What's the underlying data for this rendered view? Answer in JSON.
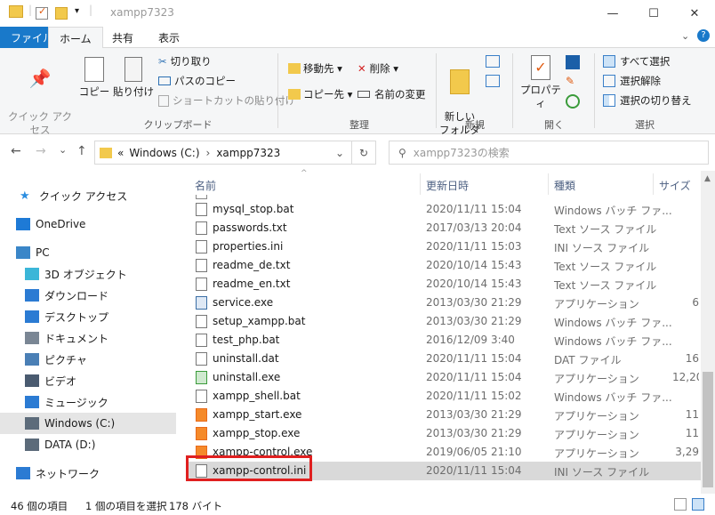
{
  "window": {
    "title": "xampp7323",
    "minimize": "—",
    "maximize": "☐",
    "close": "✕"
  },
  "tabs": {
    "file": "ファイル",
    "home": "ホーム",
    "share": "共有",
    "view": "表示"
  },
  "ribbon": {
    "pin_label": "クイック アクセス\nにピン留めする",
    "copy": "コピー",
    "paste": "貼り付け",
    "cut": "切り取り",
    "copy_path": "パスのコピー",
    "paste_shortcut": "ショートカットの貼り付け",
    "clipboard_group": "クリップボード",
    "move_to": "移動先 ▾",
    "delete": "削除 ▾",
    "copy_to": "コピー先 ▾",
    "rename": "名前の変更",
    "organize_group": "整理",
    "new_folder": "新しい\nフォルダー",
    "new_group": "新規",
    "properties": "プロパティ",
    "open_group": "開く",
    "select_all": "すべて選択",
    "select_none": "選択解除",
    "invert_selection": "選択の切り替え",
    "select_group": "選択"
  },
  "address": {
    "root": "«",
    "drive": "Windows (C:)",
    "sep1": "›",
    "folder": "xampp7323",
    "dropdown": "⌄",
    "refresh": "↻",
    "search_placeholder": "xampp7323の検索"
  },
  "nav_arrows": {
    "back": "←",
    "forward": "→",
    "down": "⌄",
    "up": "↑"
  },
  "nav": [
    {
      "label": "クイック アクセス",
      "icon": "star-icon",
      "color": "#2b8ee0"
    },
    {
      "label": "OneDrive",
      "icon": "cloud-icon",
      "color": "#1e7ad6"
    },
    {
      "label": "PC",
      "icon": "pc-icon",
      "color": "#3a86c8"
    },
    {
      "label": "3D オブジェクト",
      "icon": "cube-icon",
      "color": "#3bb6d8"
    },
    {
      "label": "ダウンロード",
      "icon": "download-icon",
      "color": "#2b7bd3"
    },
    {
      "label": "デスクトップ",
      "icon": "desktop-icon",
      "color": "#2b7bd3"
    },
    {
      "label": "ドキュメント",
      "icon": "document-icon",
      "color": "#7a8694"
    },
    {
      "label": "ピクチャ",
      "icon": "picture-icon",
      "color": "#4a7fb5"
    },
    {
      "label": "ビデオ",
      "icon": "video-icon",
      "color": "#4a5b70"
    },
    {
      "label": "ミュージック",
      "icon": "music-icon",
      "color": "#2b7bd3"
    },
    {
      "label": "Windows (C:)",
      "icon": "drive-icon",
      "color": "#5c6b7a"
    },
    {
      "label": "DATA (D:)",
      "icon": "drive-icon",
      "color": "#5c6b7a"
    },
    {
      "label": "ネットワーク",
      "icon": "network-icon",
      "color": "#2b7bd3"
    }
  ],
  "columns": {
    "name": "名前",
    "date": "更新日時",
    "type": "種類",
    "size": "サイズ"
  },
  "files": [
    {
      "name": "mysql_stop.bat",
      "date": "2020/11/11 15:04",
      "type": "Windows バッチ ファ...",
      "size": "",
      "icon": "bat"
    },
    {
      "name": "passwords.txt",
      "date": "2017/03/13 20:04",
      "type": "Text ソース ファイル",
      "size": "",
      "icon": "txt"
    },
    {
      "name": "properties.ini",
      "date": "2020/11/11 15:03",
      "type": "INI ソース ファイル",
      "size": "",
      "icon": "ini"
    },
    {
      "name": "readme_de.txt",
      "date": "2020/10/14 15:43",
      "type": "Text ソース ファイル",
      "size": "",
      "icon": "txt"
    },
    {
      "name": "readme_en.txt",
      "date": "2020/10/14 15:43",
      "type": "Text ソース ファイル",
      "size": "",
      "icon": "txt"
    },
    {
      "name": "service.exe",
      "date": "2013/03/30 21:29",
      "type": "アプリケーション",
      "size": "6",
      "icon": "exe"
    },
    {
      "name": "setup_xampp.bat",
      "date": "2013/03/30 21:29",
      "type": "Windows バッチ ファ...",
      "size": "",
      "icon": "bat"
    },
    {
      "name": "test_php.bat",
      "date": "2016/12/09 3:40",
      "type": "Windows バッチ ファ...",
      "size": "",
      "icon": "bat"
    },
    {
      "name": "uninstall.dat",
      "date": "2020/11/11 15:04",
      "type": "DAT ファイル",
      "size": "16",
      "icon": "dat"
    },
    {
      "name": "uninstall.exe",
      "date": "2020/11/11 15:04",
      "type": "アプリケーション",
      "size": "12,20",
      "icon": "uninst"
    },
    {
      "name": "xampp_shell.bat",
      "date": "2020/11/11 15:02",
      "type": "Windows バッチ ファ...",
      "size": "",
      "icon": "bat"
    },
    {
      "name": "xampp_start.exe",
      "date": "2013/03/30 21:29",
      "type": "アプリケーション",
      "size": "11",
      "icon": "xampp"
    },
    {
      "name": "xampp_stop.exe",
      "date": "2013/03/30 21:29",
      "type": "アプリケーション",
      "size": "11",
      "icon": "xampp"
    },
    {
      "name": "xampp-control.exe",
      "date": "2019/06/05 21:10",
      "type": "アプリケーション",
      "size": "3,29",
      "icon": "xampp"
    },
    {
      "name": "xampp-control.ini",
      "date": "2020/11/11 15:04",
      "type": "INI ソース ファイル",
      "size": "",
      "icon": "ini"
    }
  ],
  "selected_index": 14,
  "highlight_color": "#e02020",
  "status": {
    "count": "46 個の項目",
    "selected": "1 個の項目を選択",
    "size": "178 バイト"
  }
}
